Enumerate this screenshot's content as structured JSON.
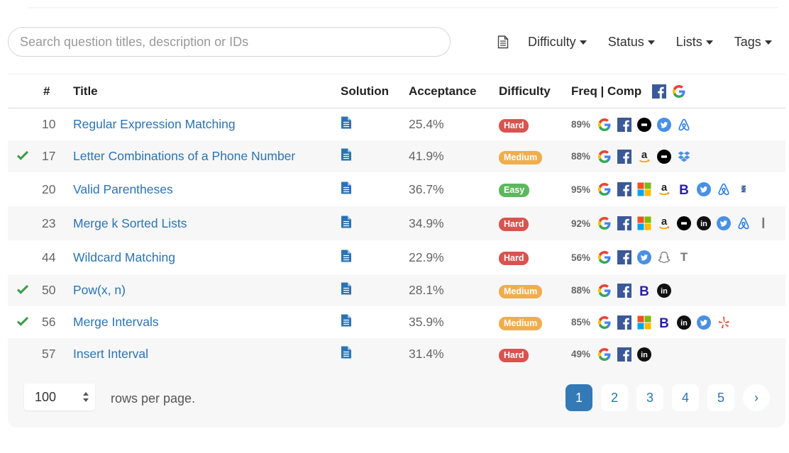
{
  "search": {
    "placeholder": "Search question titles, description or IDs"
  },
  "toolbar": {
    "difficulty_label": "Difficulty",
    "status_label": "Status",
    "lists_label": "Lists",
    "tags_label": "Tags"
  },
  "table": {
    "headers": {
      "num": "#",
      "title": "Title",
      "solution": "Solution",
      "acceptance": "Acceptance",
      "difficulty": "Difficulty",
      "freq": "Freq | Comp"
    },
    "rows": [
      {
        "num": "10",
        "title": "Regular Expression Matching",
        "acceptance": "25.4%",
        "difficulty": "Hard",
        "freq": "89%",
        "solved": false,
        "companies": [
          "google-icon",
          "facebook-icon",
          "uber-icon",
          "twitter-icon",
          "airbnb-icon"
        ]
      },
      {
        "num": "17",
        "title": "Letter Combinations of a Phone Number",
        "acceptance": "41.9%",
        "difficulty": "Medium",
        "freq": "88%",
        "solved": true,
        "companies": [
          "google-icon",
          "facebook-icon",
          "amazon-icon",
          "uber-icon",
          "dropbox-icon"
        ]
      },
      {
        "num": "20",
        "title": "Valid Parentheses",
        "acceptance": "36.7%",
        "difficulty": "Easy",
        "freq": "95%",
        "solved": false,
        "companies": [
          "google-icon",
          "facebook-icon",
          "microsoft-icon",
          "amazon-icon",
          "bloomberg-icon",
          "twitter-icon",
          "airbnb-icon",
          "zenefits-icon"
        ]
      },
      {
        "num": "23",
        "title": "Merge k Sorted Lists",
        "acceptance": "34.9%",
        "difficulty": "Hard",
        "freq": "92%",
        "solved": false,
        "companies": [
          "google-icon",
          "facebook-icon",
          "microsoft-icon",
          "amazon-icon",
          "uber-icon",
          "linkedin-icon",
          "twitter-icon",
          "airbnb-icon",
          "ixl-icon"
        ]
      },
      {
        "num": "44",
        "title": "Wildcard Matching",
        "acceptance": "22.9%",
        "difficulty": "Hard",
        "freq": "56%",
        "solved": false,
        "companies": [
          "google-icon",
          "facebook-icon",
          "twitter-icon",
          "snapchat-icon",
          "twosigma-icon"
        ]
      },
      {
        "num": "50",
        "title": "Pow(x, n)",
        "acceptance": "28.1%",
        "difficulty": "Medium",
        "freq": "88%",
        "solved": true,
        "companies": [
          "google-icon",
          "facebook-icon",
          "bloomberg-icon",
          "linkedin-icon"
        ]
      },
      {
        "num": "56",
        "title": "Merge Intervals",
        "acceptance": "35.9%",
        "difficulty": "Medium",
        "freq": "85%",
        "solved": true,
        "companies": [
          "google-icon",
          "facebook-icon",
          "microsoft-icon",
          "bloomberg-icon",
          "linkedin-icon",
          "twitter-icon",
          "yelp-icon"
        ]
      },
      {
        "num": "57",
        "title": "Insert Interval",
        "acceptance": "31.4%",
        "difficulty": "Hard",
        "freq": "49%",
        "solved": false,
        "companies": [
          "google-icon",
          "facebook-icon",
          "linkedin-icon"
        ]
      }
    ]
  },
  "footer": {
    "rows_per_page_value": "100",
    "rows_per_page_label": "rows per page.",
    "pages": [
      "1",
      "2",
      "3",
      "4",
      "5"
    ],
    "active_page": "1",
    "next_label": "›"
  },
  "colors": {
    "link": "#2a73b4",
    "hard": "#d9534f",
    "medium": "#f0ad4e",
    "easy": "#5cb85c",
    "active_page": "#337ab7",
    "check": "#3d9b47"
  }
}
